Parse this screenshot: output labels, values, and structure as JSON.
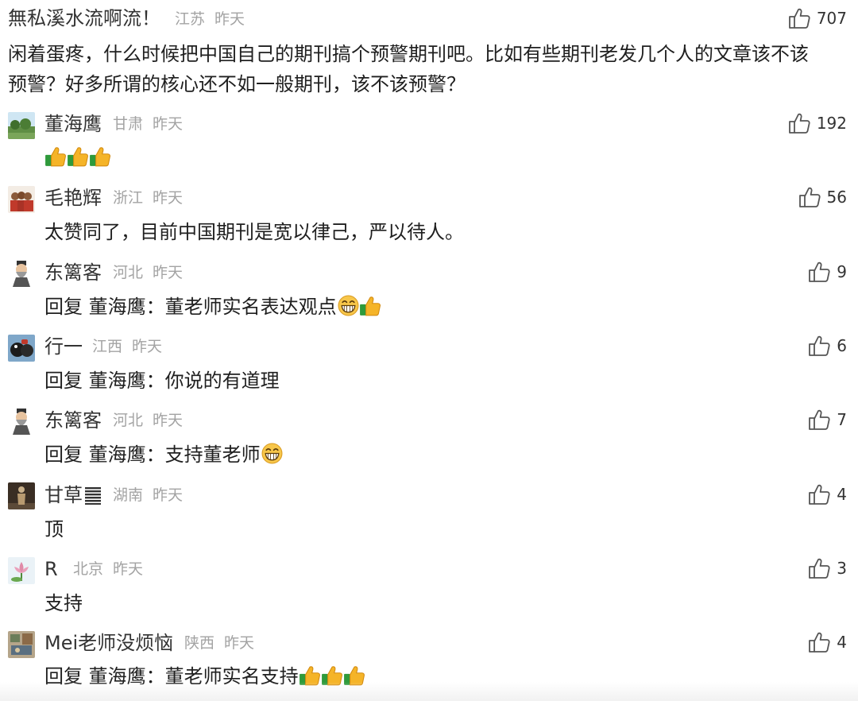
{
  "main": {
    "name": "無私溪水流啊流！",
    "region": "江苏",
    "time": "昨天",
    "likes": "707",
    "text_line1": "闲着蛋疼，什么时候把中国自己的期刊搞个预警期刊吧。比如有些期刊老发几个人的文章该不该",
    "text_line2": "预警？好多所谓的核心还不如一般期刊，该不该预警？"
  },
  "replies": [
    {
      "name": "董海鹰",
      "region": "甘肃",
      "time": "昨天",
      "likes": "192",
      "text": "",
      "avatar": "landscape-avatar"
    },
    {
      "name": "毛艳辉",
      "region": "浙江",
      "time": "昨天",
      "likes": "56",
      "text": "太赞同了，目前中国期刊是宽以律己，严以待人。",
      "avatar": "group-photo-avatar"
    },
    {
      "name": "东篱客",
      "region": "河北",
      "time": "昨天",
      "likes": "9",
      "text": "回复 董海鹰：董老师实名表达观点",
      "avatar": "sage-avatar"
    },
    {
      "name": "行一",
      "region": "江西",
      "time": "昨天",
      "likes": "6",
      "text": "回复 董海鹰：你说的有道理",
      "avatar": "cartoon-avatar"
    },
    {
      "name": "东篱客",
      "region": "河北",
      "time": "昨天",
      "likes": "7",
      "text": "回复 董海鹰：支持董老师",
      "avatar": "sage-avatar"
    },
    {
      "name": "甘草",
      "region": "湖南",
      "time": "昨天",
      "likes": "4",
      "text": "顶",
      "avatar": "statue-avatar"
    },
    {
      "name": "R",
      "region": "北京",
      "time": "昨天",
      "likes": "3",
      "text": "支持",
      "avatar": "lotus-avatar"
    },
    {
      "name": "Mei老师没烦恼",
      "region": "陕西",
      "time": "昨天",
      "likes": "4",
      "text": "回复 董海鹰：董老师实名支持",
      "avatar": "painting-avatar"
    }
  ],
  "icons": {
    "like": "thumbs-up-outline-icon",
    "thumbs_emoji": "thumbs-up-emoji-icon",
    "grin_emoji": "grinning-emoji-icon",
    "hexagram": "hexagram-icon"
  },
  "colors": {
    "meta": "#a3a3a3",
    "text": "#1f1f1f",
    "icon": "#555555"
  }
}
